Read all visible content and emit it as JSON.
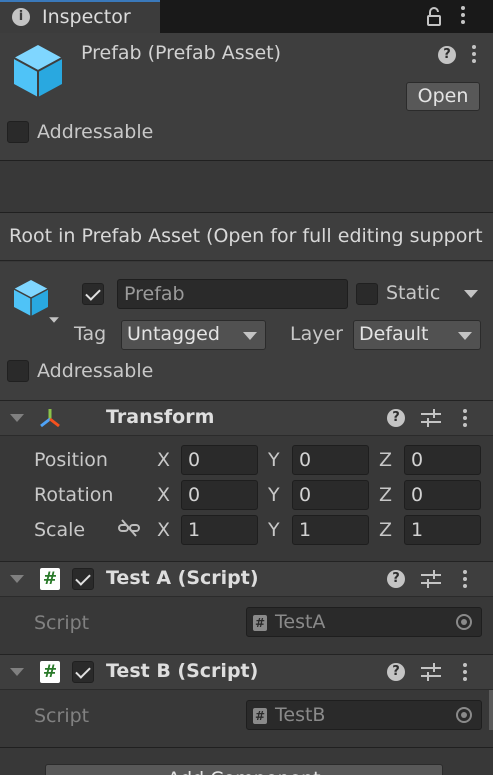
{
  "window": {
    "tab_title": "Inspector"
  },
  "asset_header": {
    "title": "Prefab (Prefab Asset)",
    "open_button": "Open",
    "addressable_label": "Addressable"
  },
  "notice": "Root in Prefab Asset (Open for full editing support",
  "gameobject": {
    "name": "Prefab",
    "active": true,
    "static_label": "Static",
    "tag_label": "Tag",
    "tag_value": "Untagged",
    "layer_label": "Layer",
    "layer_value": "Default",
    "addressable_label": "Addressable"
  },
  "transform": {
    "title": "Transform",
    "rows": [
      {
        "label": "Position",
        "x": "0",
        "y": "0",
        "z": "0"
      },
      {
        "label": "Rotation",
        "x": "0",
        "y": "0",
        "z": "0"
      },
      {
        "label": "Scale",
        "x": "1",
        "y": "1",
        "z": "1"
      }
    ],
    "axis_x": "X",
    "axis_y": "Y",
    "axis_z": "Z"
  },
  "components": [
    {
      "title": "Test A (Script)",
      "enabled": true,
      "script_label": "Script",
      "script_value": "TestA"
    },
    {
      "title": "Test B (Script)",
      "enabled": true,
      "script_label": "Script",
      "script_value": "TestB"
    }
  ],
  "add_component": "Add Component",
  "colors": {
    "background": "#383838",
    "header": "#3e3e3e",
    "field": "#2a2a2a",
    "accent_tab": "#3a79bb",
    "prefab_icon": "#4fc3f7"
  }
}
